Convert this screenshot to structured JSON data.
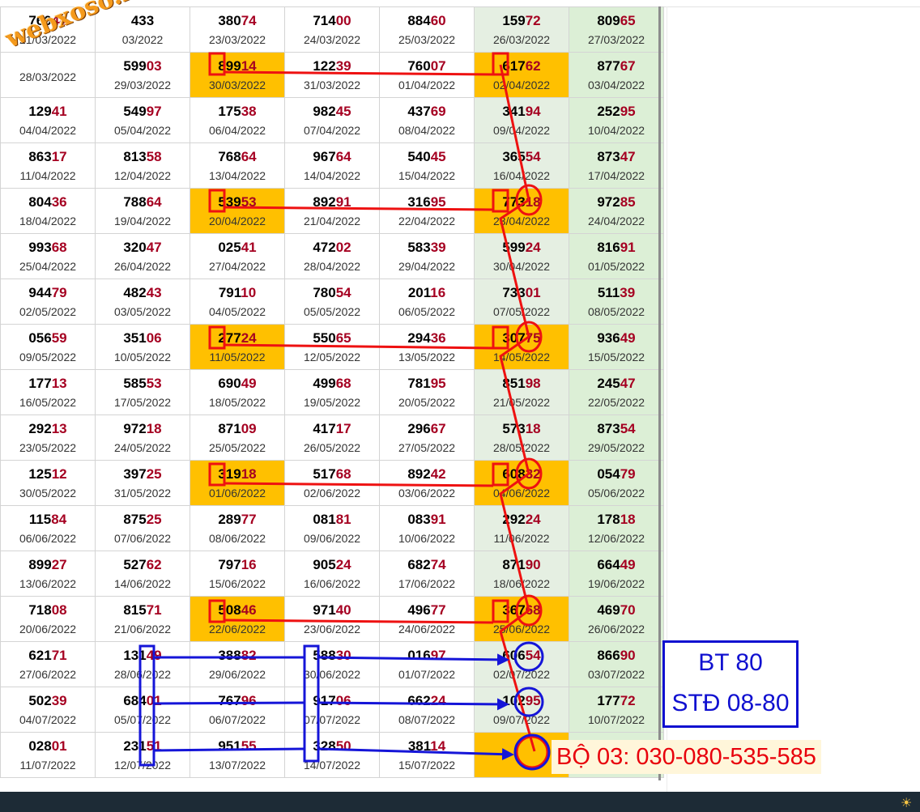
{
  "watermark": "webxoso.net",
  "table": {
    "rows": [
      [
        {
          "p": "760",
          "t": "44",
          "d": "21/03/2022"
        },
        {
          "p": "433",
          "t": "",
          "d": "03/2022"
        },
        {
          "p": "380",
          "t": "74",
          "d": "23/03/2022"
        },
        {
          "p": "714",
          "t": "00",
          "d": "24/03/2022"
        },
        {
          "p": "884",
          "t": "60",
          "d": "25/03/2022"
        },
        {
          "p": "159",
          "t": "72",
          "d": "26/03/2022"
        },
        {
          "p": "809",
          "t": "65",
          "d": "27/03/2022"
        }
      ],
      [
        {
          "p": "",
          "t": "",
          "d": "28/03/2022"
        },
        {
          "p": "599",
          "t": "03",
          "d": "29/03/2022"
        },
        {
          "p": "899",
          "t": "14",
          "d": "30/03/2022",
          "hl": true
        },
        {
          "p": "122",
          "t": "39",
          "d": "31/03/2022"
        },
        {
          "p": "760",
          "t": "07",
          "d": "01/04/2022"
        },
        {
          "p": "617",
          "t": "62",
          "d": "02/04/2022",
          "hl": true
        },
        {
          "p": "877",
          "t": "67",
          "d": "03/04/2022"
        }
      ],
      [
        {
          "p": "129",
          "t": "41",
          "d": "04/04/2022"
        },
        {
          "p": "549",
          "t": "97",
          "d": "05/04/2022"
        },
        {
          "p": "175",
          "t": "38",
          "d": "06/04/2022"
        },
        {
          "p": "982",
          "t": "45",
          "d": "07/04/2022"
        },
        {
          "p": "437",
          "t": "69",
          "d": "08/04/2022"
        },
        {
          "p": "341",
          "t": "94",
          "d": "09/04/2022"
        },
        {
          "p": "252",
          "t": "95",
          "d": "10/04/2022"
        }
      ],
      [
        {
          "p": "863",
          "t": "17",
          "d": "11/04/2022"
        },
        {
          "p": "813",
          "t": "58",
          "d": "12/04/2022"
        },
        {
          "p": "768",
          "t": "64",
          "d": "13/04/2022"
        },
        {
          "p": "967",
          "t": "64",
          "d": "14/04/2022"
        },
        {
          "p": "540",
          "t": "45",
          "d": "15/04/2022"
        },
        {
          "p": "365",
          "t": "54",
          "d": "16/04/2022"
        },
        {
          "p": "873",
          "t": "47",
          "d": "17/04/2022"
        }
      ],
      [
        {
          "p": "804",
          "t": "36",
          "d": "18/04/2022"
        },
        {
          "p": "788",
          "t": "64",
          "d": "19/04/2022"
        },
        {
          "p": "539",
          "t": "53",
          "d": "20/04/2022",
          "hl": true
        },
        {
          "p": "892",
          "t": "91",
          "d": "21/04/2022"
        },
        {
          "p": "316",
          "t": "95",
          "d": "22/04/2022"
        },
        {
          "p": "773",
          "t": "18",
          "d": "23/04/2022",
          "hl": true
        },
        {
          "p": "972",
          "t": "85",
          "d": "24/04/2022"
        }
      ],
      [
        {
          "p": "993",
          "t": "68",
          "d": "25/04/2022"
        },
        {
          "p": "320",
          "t": "47",
          "d": "26/04/2022"
        },
        {
          "p": "025",
          "t": "41",
          "d": "27/04/2022"
        },
        {
          "p": "472",
          "t": "02",
          "d": "28/04/2022"
        },
        {
          "p": "583",
          "t": "39",
          "d": "29/04/2022"
        },
        {
          "p": "599",
          "t": "24",
          "d": "30/04/2022"
        },
        {
          "p": "816",
          "t": "91",
          "d": "01/05/2022"
        }
      ],
      [
        {
          "p": "944",
          "t": "79",
          "d": "02/05/2022"
        },
        {
          "p": "482",
          "t": "43",
          "d": "03/05/2022"
        },
        {
          "p": "791",
          "t": "10",
          "d": "04/05/2022"
        },
        {
          "p": "780",
          "t": "54",
          "d": "05/05/2022"
        },
        {
          "p": "201",
          "t": "16",
          "d": "06/05/2022"
        },
        {
          "p": "733",
          "t": "01",
          "d": "07/05/2022"
        },
        {
          "p": "511",
          "t": "39",
          "d": "08/05/2022"
        }
      ],
      [
        {
          "p": "056",
          "t": "59",
          "d": "09/05/2022"
        },
        {
          "p": "351",
          "t": "06",
          "d": "10/05/2022"
        },
        {
          "p": "277",
          "t": "24",
          "d": "11/05/2022",
          "hl": true
        },
        {
          "p": "550",
          "t": "65",
          "d": "12/05/2022"
        },
        {
          "p": "294",
          "t": "36",
          "d": "13/05/2022"
        },
        {
          "p": "307",
          "t": "75",
          "d": "14/05/2022",
          "hl": true
        },
        {
          "p": "936",
          "t": "49",
          "d": "15/05/2022"
        }
      ],
      [
        {
          "p": "177",
          "t": "13",
          "d": "16/05/2022"
        },
        {
          "p": "585",
          "t": "53",
          "d": "17/05/2022"
        },
        {
          "p": "690",
          "t": "49",
          "d": "18/05/2022"
        },
        {
          "p": "499",
          "t": "68",
          "d": "19/05/2022"
        },
        {
          "p": "781",
          "t": "95",
          "d": "20/05/2022"
        },
        {
          "p": "851",
          "t": "98",
          "d": "21/05/2022"
        },
        {
          "p": "245",
          "t": "47",
          "d": "22/05/2022"
        }
      ],
      [
        {
          "p": "292",
          "t": "13",
          "d": "23/05/2022"
        },
        {
          "p": "972",
          "t": "18",
          "d": "24/05/2022"
        },
        {
          "p": "871",
          "t": "09",
          "d": "25/05/2022"
        },
        {
          "p": "417",
          "t": "17",
          "d": "26/05/2022"
        },
        {
          "p": "296",
          "t": "67",
          "d": "27/05/2022"
        },
        {
          "p": "573",
          "t": "18",
          "d": "28/05/2022"
        },
        {
          "p": "873",
          "t": "54",
          "d": "29/05/2022"
        }
      ],
      [
        {
          "p": "125",
          "t": "12",
          "d": "30/05/2022"
        },
        {
          "p": "397",
          "t": "25",
          "d": "31/05/2022"
        },
        {
          "p": "319",
          "t": "18",
          "d": "01/06/2022",
          "hl": true
        },
        {
          "p": "517",
          "t": "68",
          "d": "02/06/2022"
        },
        {
          "p": "892",
          "t": "42",
          "d": "03/06/2022"
        },
        {
          "p": "608",
          "t": "32",
          "d": "04/06/2022",
          "hl": true
        },
        {
          "p": "054",
          "t": "79",
          "d": "05/06/2022"
        }
      ],
      [
        {
          "p": "115",
          "t": "84",
          "d": "06/06/2022"
        },
        {
          "p": "875",
          "t": "25",
          "d": "07/06/2022"
        },
        {
          "p": "289",
          "t": "77",
          "d": "08/06/2022"
        },
        {
          "p": "081",
          "t": "81",
          "d": "09/06/2022"
        },
        {
          "p": "083",
          "t": "91",
          "d": "10/06/2022"
        },
        {
          "p": "292",
          "t": "24",
          "d": "11/06/2022"
        },
        {
          "p": "178",
          "t": "18",
          "d": "12/06/2022"
        }
      ],
      [
        {
          "p": "899",
          "t": "27",
          "d": "13/06/2022"
        },
        {
          "p": "527",
          "t": "62",
          "d": "14/06/2022"
        },
        {
          "p": "797",
          "t": "16",
          "d": "15/06/2022"
        },
        {
          "p": "905",
          "t": "24",
          "d": "16/06/2022"
        },
        {
          "p": "682",
          "t": "74",
          "d": "17/06/2022"
        },
        {
          "p": "871",
          "t": "90",
          "d": "18/06/2022"
        },
        {
          "p": "664",
          "t": "49",
          "d": "19/06/2022"
        }
      ],
      [
        {
          "p": "718",
          "t": "08",
          "d": "20/06/2022"
        },
        {
          "p": "815",
          "t": "71",
          "d": "21/06/2022"
        },
        {
          "p": "508",
          "t": "46",
          "d": "22/06/2022",
          "hl": true
        },
        {
          "p": "971",
          "t": "40",
          "d": "23/06/2022"
        },
        {
          "p": "496",
          "t": "77",
          "d": "24/06/2022"
        },
        {
          "p": "367",
          "t": "68",
          "d": "25/06/2022",
          "hl": true
        },
        {
          "p": "469",
          "t": "70",
          "d": "26/06/2022"
        }
      ],
      [
        {
          "p": "621",
          "t": "71",
          "d": "27/06/2022"
        },
        {
          "p": "131",
          "t": "49",
          "d": "28/06/2022"
        },
        {
          "p": "388",
          "t": "82",
          "d": "29/06/2022"
        },
        {
          "p": "588",
          "t": "30",
          "d": "30/06/2022"
        },
        {
          "p": "016",
          "t": "97",
          "d": "01/07/2022"
        },
        {
          "p": "606",
          "t": "54",
          "d": "02/07/2022"
        },
        {
          "p": "866",
          "t": "90",
          "d": "03/07/2022"
        }
      ],
      [
        {
          "p": "502",
          "t": "39",
          "d": "04/07/2022"
        },
        {
          "p": "684",
          "t": "01",
          "d": "05/07/2022"
        },
        {
          "p": "767",
          "t": "96",
          "d": "06/07/2022"
        },
        {
          "p": "917",
          "t": "06",
          "d": "07/07/2022"
        },
        {
          "p": "662",
          "t": "24",
          "d": "08/07/2022"
        },
        {
          "p": "102",
          "t": "95",
          "d": "09/07/2022"
        },
        {
          "p": "177",
          "t": "72",
          "d": "10/07/2022"
        }
      ],
      [
        {
          "p": "028",
          "t": "01",
          "d": "11/07/2022"
        },
        {
          "p": "231",
          "t": "51",
          "d": "12/07/2022"
        },
        {
          "p": "951",
          "t": "55",
          "d": "13/07/2022"
        },
        {
          "p": "328",
          "t": "50",
          "d": "14/07/2022"
        },
        {
          "p": "381",
          "t": "14",
          "d": "15/07/2022"
        },
        {
          "p": "",
          "t": "",
          "d": "",
          "hl": true
        },
        {
          "p": "",
          "t": "",
          "d": ""
        }
      ]
    ]
  },
  "annotations": {
    "bt_line1": "BT 80",
    "bt_line2": "STĐ 08-80",
    "bo_label": "BỘ 03: 030-080-535-585"
  },
  "colors": {
    "highlight": "#ffc000",
    "red_mark": "#ee1111",
    "blue_mark": "#1515d8",
    "weekend_col": "#dcefd6"
  }
}
